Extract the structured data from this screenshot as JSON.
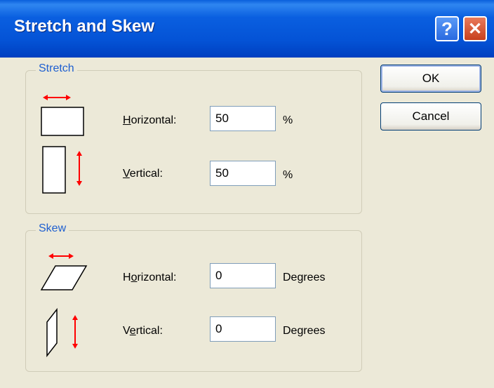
{
  "window": {
    "title": "Stretch and Skew",
    "help_label": "?",
    "close_label": "✕"
  },
  "stretch": {
    "group_label": "Stretch",
    "horizontal": {
      "mnemonic": "H",
      "label_rest": "orizontal:",
      "value": "50",
      "unit": "%"
    },
    "vertical": {
      "mnemonic": "V",
      "label_rest": "ertical:",
      "value": "50",
      "unit": "%"
    }
  },
  "skew": {
    "group_label": "Skew",
    "horizontal": {
      "prefix": "H",
      "mnemonic": "o",
      "label_rest": "rizontal:",
      "value": "0",
      "unit": "Degrees"
    },
    "vertical": {
      "prefix": "V",
      "mnemonic": "e",
      "label_rest": "rtical:",
      "value": "0",
      "unit": "Degrees"
    }
  },
  "buttons": {
    "ok": "OK",
    "cancel": "Cancel"
  },
  "colors": {
    "titlebar": "#0453d6",
    "accent_arrow": "#ff0000",
    "group_label": "#1e5fd0",
    "dialog_bg": "#ece9d8"
  },
  "icons": {
    "stretch_horizontal": "stretch-horizontal-icon",
    "stretch_vertical": "stretch-vertical-icon",
    "skew_horizontal": "skew-horizontal-icon",
    "skew_vertical": "skew-vertical-icon"
  }
}
